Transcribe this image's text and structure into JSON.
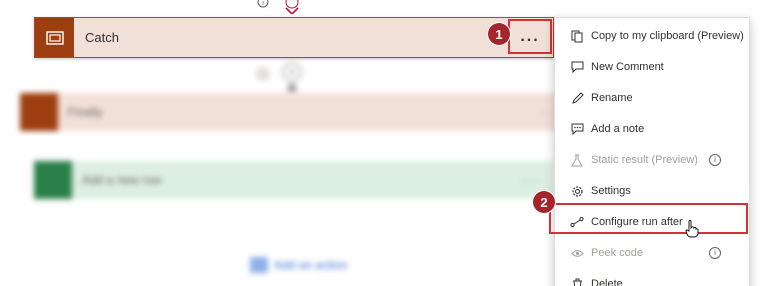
{
  "flow": {
    "catch_card": {
      "title": "Catch"
    },
    "more_button": {
      "label": "..."
    },
    "finally_card": {
      "title": "Finally",
      "dots": "· ·"
    },
    "add_row_card": {
      "title": "Add a new row",
      "dots": "· · ·"
    },
    "add_action": {
      "label": "Add an action"
    }
  },
  "badges": {
    "one": "1",
    "two": "2"
  },
  "menu": {
    "items": [
      {
        "label": "Copy to my clipboard (Preview)",
        "icon": "clipboard-icon",
        "disabled": false
      },
      {
        "label": "New Comment",
        "icon": "comment-icon",
        "disabled": false
      },
      {
        "label": "Rename",
        "icon": "pencil-icon",
        "disabled": false
      },
      {
        "label": "Add a note",
        "icon": "note-icon",
        "disabled": false
      },
      {
        "label": "Static result (Preview)",
        "icon": "flask-icon",
        "disabled": true,
        "info": "i"
      },
      {
        "label": "Settings",
        "icon": "gear-icon",
        "disabled": false
      },
      {
        "label": "Configure run after",
        "icon": "run-after-icon",
        "disabled": false
      },
      {
        "label": "Peek code",
        "icon": "eye-icon",
        "disabled": true,
        "info": "i"
      },
      {
        "label": "Delete",
        "icon": "trash-icon",
        "disabled": false
      }
    ]
  },
  "colors": {
    "catch_bg": "#f1e0d8",
    "catch_icon": "#9d3e10",
    "highlight": "#d13438",
    "badge": "#a4262c",
    "excel_green": "#2a8049"
  }
}
